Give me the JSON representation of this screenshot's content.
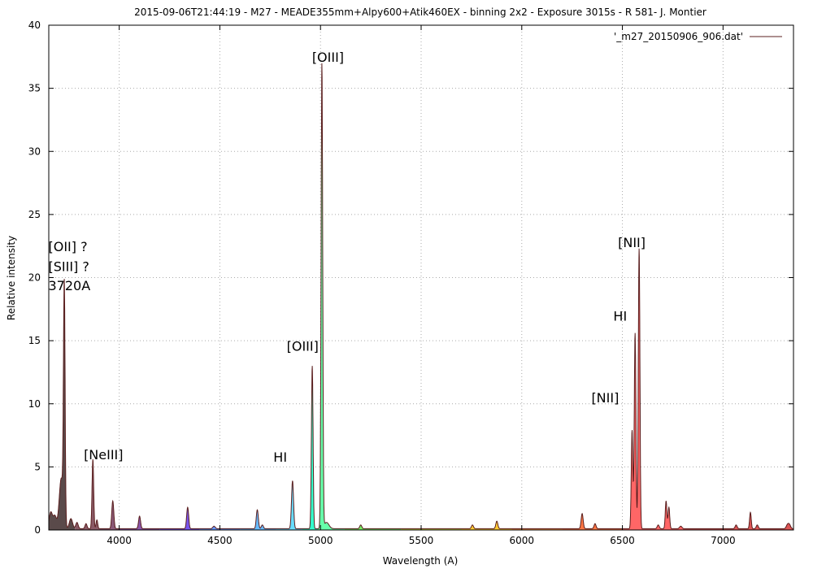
{
  "chart_data": {
    "type": "area",
    "title": "2015-09-06T21:44:19 - M27 - MEADE355mm+Alpy600+Atik460EX - binning 2x2 - Exposure 3015s - R 581- J. Montier",
    "xlabel": "Wavelength (A)",
    "ylabel": "Relative intensity",
    "xlim": [
      3650,
      7350
    ],
    "ylim": [
      0,
      40
    ],
    "xticks": [
      4000,
      4500,
      5000,
      5500,
      6000,
      6500,
      7000
    ],
    "yticks": [
      0,
      5,
      10,
      15,
      20,
      25,
      30,
      35,
      40
    ],
    "grid": true,
    "legend": {
      "position": "top-right",
      "entries": [
        "'_m27_20150906_906.dat'"
      ]
    },
    "line_color": "#5b1f1f",
    "baseline": 0.1,
    "peaks": [
      {
        "x": 3660,
        "y": 1.3,
        "w": 8
      },
      {
        "x": 3680,
        "y": 1.0,
        "w": 8
      },
      {
        "x": 3712,
        "y": 4.0,
        "w": 10
      },
      {
        "x": 3727,
        "y": 18.5,
        "w": 4
      },
      {
        "x": 3760,
        "y": 0.8,
        "w": 8
      },
      {
        "x": 3790,
        "y": 0.5,
        "w": 6
      },
      {
        "x": 3835,
        "y": 0.4,
        "w": 5
      },
      {
        "x": 3869,
        "y": 5.5,
        "w": 4
      },
      {
        "x": 3889,
        "y": 0.7,
        "w": 4
      },
      {
        "x": 3968,
        "y": 2.2,
        "w": 5
      },
      {
        "x": 4101,
        "y": 1.0,
        "w": 5
      },
      {
        "x": 4340,
        "y": 1.7,
        "w": 5
      },
      {
        "x": 4471,
        "y": 0.2,
        "w": 6
      },
      {
        "x": 4686,
        "y": 1.5,
        "w": 5
      },
      {
        "x": 4711,
        "y": 0.3,
        "w": 5
      },
      {
        "x": 4861,
        "y": 3.8,
        "w": 5
      },
      {
        "x": 4959,
        "y": 12.9,
        "w": 4
      },
      {
        "x": 5007,
        "y": 36.8,
        "w": 4
      },
      {
        "x": 5030,
        "y": 0.5,
        "w": 12
      },
      {
        "x": 5200,
        "y": 0.3,
        "w": 5
      },
      {
        "x": 5755,
        "y": 0.3,
        "w": 5
      },
      {
        "x": 5876,
        "y": 0.6,
        "w": 5
      },
      {
        "x": 6300,
        "y": 1.2,
        "w": 5
      },
      {
        "x": 6364,
        "y": 0.4,
        "w": 5
      },
      {
        "x": 6548,
        "y": 7.8,
        "w": 4
      },
      {
        "x": 6563,
        "y": 15.5,
        "w": 4
      },
      {
        "x": 6583,
        "y": 22.2,
        "w": 4
      },
      {
        "x": 6678,
        "y": 0.3,
        "w": 5
      },
      {
        "x": 6717,
        "y": 2.2,
        "w": 4
      },
      {
        "x": 6731,
        "y": 1.7,
        "w": 4
      },
      {
        "x": 6790,
        "y": 0.2,
        "w": 6
      },
      {
        "x": 7065,
        "y": 0.3,
        "w": 5
      },
      {
        "x": 7136,
        "y": 1.3,
        "w": 4
      },
      {
        "x": 7170,
        "y": 0.3,
        "w": 5
      },
      {
        "x": 7320,
        "y": 0.3,
        "w": 6
      },
      {
        "x": 7330,
        "y": 0.3,
        "w": 6
      }
    ],
    "fill_bands": [
      {
        "from": 3650,
        "to": 3780,
        "color": "#5a4a4a"
      },
      {
        "from": 3780,
        "to": 3900,
        "color": "#8a5a66"
      },
      {
        "from": 3900,
        "to": 4000,
        "color": "#8a5a77"
      },
      {
        "from": 4000,
        "to": 4200,
        "color": "#8a55aa"
      },
      {
        "from": 4200,
        "to": 4400,
        "color": "#7755ee"
      },
      {
        "from": 4400,
        "to": 4600,
        "color": "#6699ff"
      },
      {
        "from": 4600,
        "to": 4780,
        "color": "#66bbff"
      },
      {
        "from": 4780,
        "to": 4910,
        "color": "#66ddff"
      },
      {
        "from": 4910,
        "to": 4985,
        "color": "#33ffcc"
      },
      {
        "from": 4985,
        "to": 5120,
        "color": "#66ffaa"
      },
      {
        "from": 5120,
        "to": 5400,
        "color": "#77ee66"
      },
      {
        "from": 5400,
        "to": 5700,
        "color": "#ccdd44"
      },
      {
        "from": 5700,
        "to": 5950,
        "color": "#ffcc33"
      },
      {
        "from": 5950,
        "to": 6200,
        "color": "#ff9944"
      },
      {
        "from": 6200,
        "to": 6500,
        "color": "#ff7744"
      },
      {
        "from": 6500,
        "to": 6800,
        "color": "#ff6666"
      },
      {
        "from": 6800,
        "to": 7350,
        "color": "#dd5555"
      }
    ],
    "annotations": [
      {
        "text": "[OIII]",
        "x": 4958,
        "y": 37.1
      },
      {
        "text": "[OII] ?",
        "x": 3648,
        "y": 22.1
      },
      {
        "text": "[SIII] ?",
        "x": 3648,
        "y": 20.5
      },
      {
        "text": "3720A",
        "x": 3648,
        "y": 19.0
      },
      {
        "text": "[OIII]",
        "x": 4832,
        "y": 14.2
      },
      {
        "text": "HI",
        "x": 4766,
        "y": 5.4
      },
      {
        "text": "[NeIII]",
        "x": 3824,
        "y": 5.6
      },
      {
        "text": "[NII]",
        "x": 6478,
        "y": 22.4
      },
      {
        "text": "HI",
        "x": 6455,
        "y": 16.6
      },
      {
        "text": "[NII]",
        "x": 6346,
        "y": 10.1
      }
    ]
  }
}
